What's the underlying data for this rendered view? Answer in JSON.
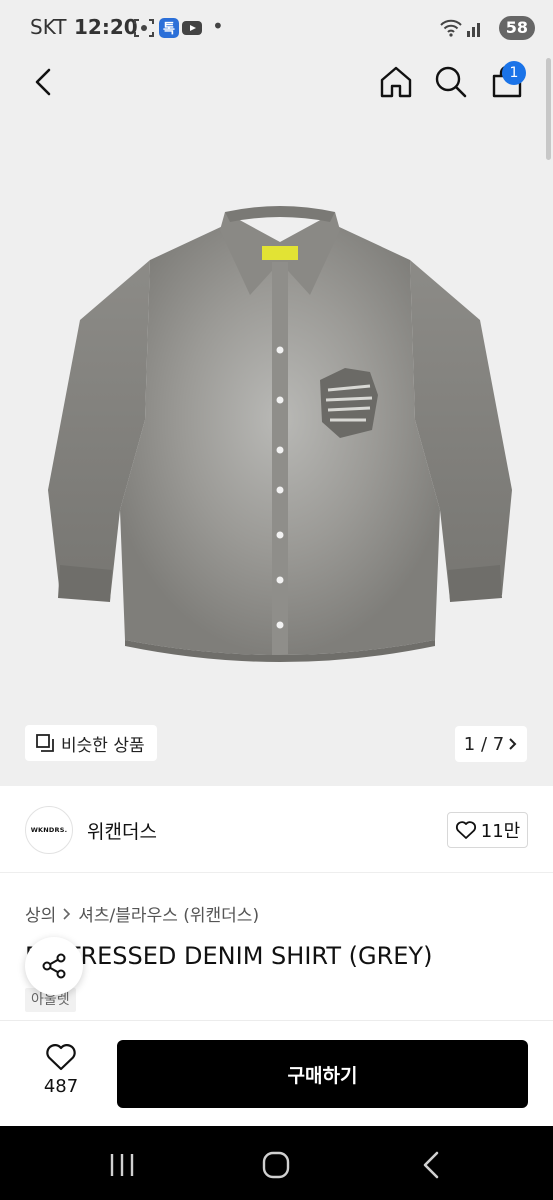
{
  "status_bar": {
    "carrier": "SKT",
    "time": "12:20",
    "battery": "58",
    "dot": "•",
    "icons": [
      "screenshot-icon",
      "app-badge-icon",
      "youtube-icon",
      "wifi-icon",
      "signal-icon"
    ]
  },
  "header": {
    "back_icon": "back-arrow-icon",
    "home_icon": "home-icon",
    "search_icon": "search-icon",
    "cart_icon": "shopping-bag-icon",
    "cart_badge": "1"
  },
  "gallery": {
    "similar_label": "비슷한 상품",
    "pager": "1 / 7"
  },
  "brand": {
    "logo_text": "WKNDRS.",
    "name": "위캔더스",
    "like_count": "11만"
  },
  "breadcrumb": {
    "category": "상의",
    "subcategory": "셔츠/블라우스 (위캔더스)"
  },
  "product": {
    "title": "DISTRESSED DENIM SHIRT (GREY)",
    "tag": "아울렛"
  },
  "actions": {
    "wish_count": "487",
    "buy_label": "구매하기"
  },
  "colors": {
    "accent": "#1a73e8",
    "buy_button": "#000000",
    "hero_bg": "#efefef"
  }
}
